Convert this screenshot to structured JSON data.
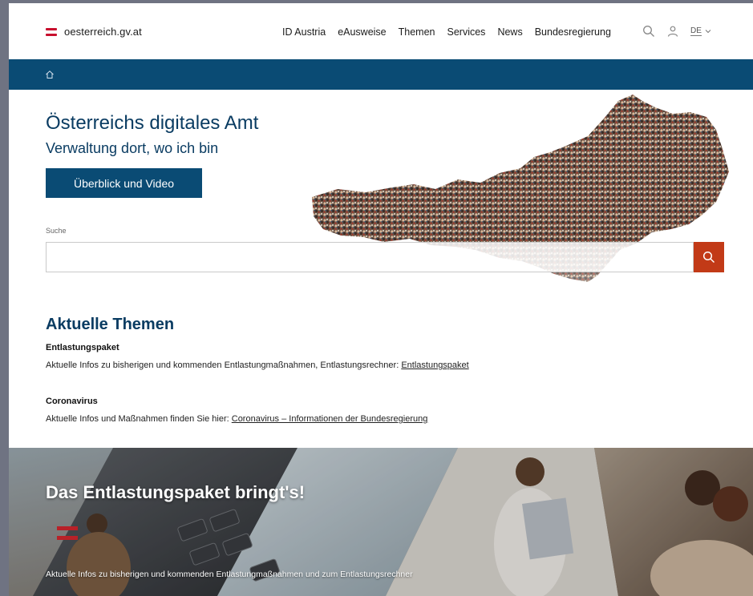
{
  "header": {
    "logo_text": "oesterreich.gv.at",
    "nav": [
      "ID Austria",
      "eAusweise",
      "Themen",
      "Services",
      "News",
      "Bundesregierung"
    ],
    "search_icon": "search-icon",
    "user_icon": "user-icon",
    "language": "DE",
    "language_icon": "chevron-down-icon"
  },
  "breadcrumb": {
    "home_icon": "home-icon"
  },
  "hero": {
    "title": "Österreichs digitales Amt",
    "subtitle": "Verwaltung dort, wo ich bin",
    "button_label": "Überblick und Video",
    "search_label": "Suche",
    "search_value": "",
    "search_button_icon": "search-icon"
  },
  "topics": {
    "title": "Aktuelle Themen",
    "items": [
      {
        "title": "Entlastungspaket",
        "text": "Aktuelle Infos zu bisherigen und kommenden Entlastungmaßnahmen, Entlastungsrechner: ",
        "link": "Entlastungspaket"
      },
      {
        "title": "Coronavirus",
        "text": "Aktuelle Infos und Maßnahmen finden Sie hier: ",
        "link": "Coronavirus – Informationen der Bundesregierung"
      }
    ]
  },
  "banner": {
    "title": "Das Entlastungspaket bringt's!",
    "text": "Aktuelle Infos zu bisherigen und kommenden Entlastungmaßnahmen und zum Entlastungsrechner"
  },
  "colors": {
    "primary": "#0a4b74",
    "heading": "#0a3c62",
    "accent": "#c23a17",
    "flag_red": "#c8102e"
  }
}
